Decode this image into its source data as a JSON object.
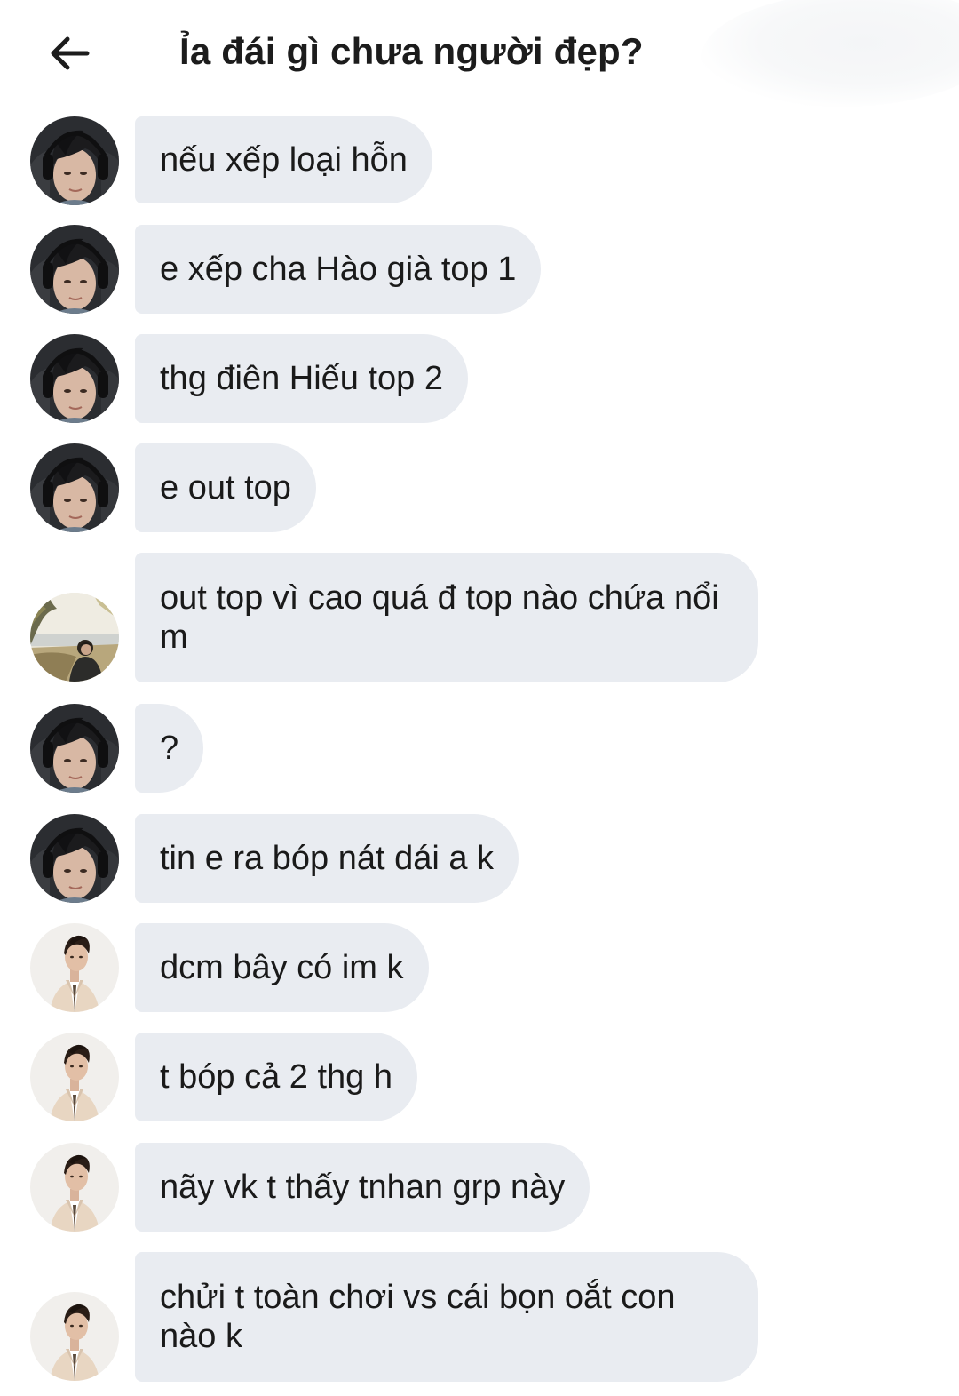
{
  "header": {
    "title": "Ỉa đái gì chưa người đẹp?",
    "back_icon": "arrow-left-icon"
  },
  "colors": {
    "bubble": "#e9ecf1",
    "text": "#1a1a1a",
    "background": "#ffffff"
  },
  "messages": [
    {
      "sender": "user-a",
      "text": "nếu xếp loại hỗn"
    },
    {
      "sender": "user-a",
      "text": "e xếp cha Hào già top 1"
    },
    {
      "sender": "user-a",
      "text": "thg điên Hiếu top 2"
    },
    {
      "sender": "user-a",
      "text": "e out top"
    },
    {
      "sender": "user-b",
      "text": "out top vì cao quá đ top nào chứa nổi m"
    },
    {
      "sender": "user-a",
      "text": "?"
    },
    {
      "sender": "user-a",
      "text": "tin e ra bóp nát dái a k"
    },
    {
      "sender": "user-c",
      "text": "dcm bây có im k"
    },
    {
      "sender": "user-c",
      "text": "t bóp cả 2 thg h"
    },
    {
      "sender": "user-c",
      "text": "nãy vk t thấy tnhan grp này"
    },
    {
      "sender": "user-c",
      "text": "chửi t toàn chơi vs cái bọn oắt con nào k"
    }
  ]
}
